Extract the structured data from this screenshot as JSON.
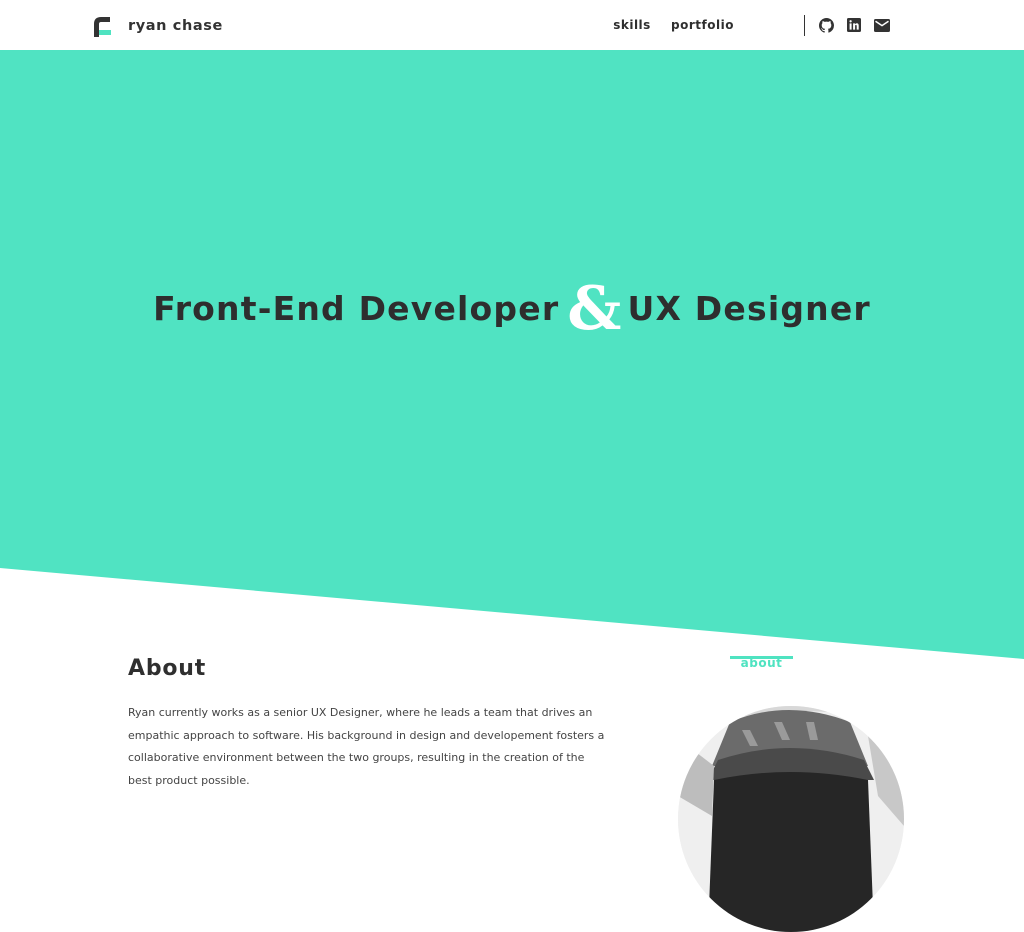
{
  "brand": {
    "name": "ryan chase",
    "logo_icon": "rc-logo-icon",
    "accent_color": "#4fe3c1"
  },
  "nav": {
    "items": [
      {
        "label": "about",
        "active": true
      },
      {
        "label": "skills",
        "active": false
      },
      {
        "label": "portfolio",
        "active": false
      }
    ],
    "social": [
      {
        "icon": "github-icon"
      },
      {
        "icon": "linkedin-icon"
      },
      {
        "icon": "email-icon"
      }
    ]
  },
  "hero": {
    "title_left": "Front-End Developer",
    "ampersand": "&",
    "title_right": "UX Designer",
    "background_color": "#50e3c2",
    "text_color": "#2e2e2e"
  },
  "about": {
    "heading": "About",
    "text": "Ryan currently works as a senior UX Designer, where he leads a team that drives an empathic approach to software. His background in design and developement fosters a collaborative environment between the two groups, resulting in the creation of the best product possible."
  },
  "colors": {
    "text_dark": "#2f2f2f",
    "background": "#ffffff"
  }
}
